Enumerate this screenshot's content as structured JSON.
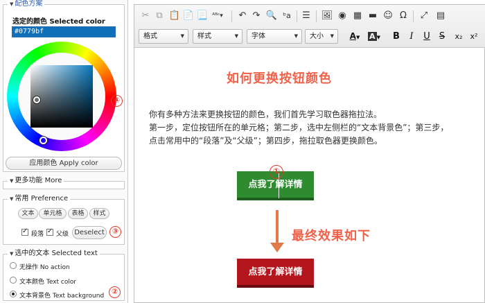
{
  "panel": {
    "color_scheme_legend": "配色方案",
    "selected_color_label": "选定的颜色 Selected color",
    "hex_value": "#0779bf",
    "apply_button": "应用颜色 Apply color",
    "more_legend": "更多功能 More",
    "preference_legend": "常用 Preference",
    "pref_buttons": [
      "文本",
      "单元格",
      "表格",
      "样式"
    ],
    "checkboxes": [
      "段落",
      "父级"
    ],
    "deselect_button": "Deselect",
    "selected_text_legend": "选中的文本 Selected text",
    "radio_options": [
      "无操作 No action",
      "文本颜色 Text color",
      "文本背景色 Text background"
    ],
    "selected_radio": 2
  },
  "badges": [
    "①",
    "②",
    "③",
    "④"
  ],
  "toolbar": {
    "format_combo": "格式",
    "style_combo": "样式",
    "font_combo": "字体",
    "size_combo": "大小",
    "bold": "B",
    "italic": "I",
    "underline": "U",
    "strike": "S",
    "subscript": "x₂",
    "superscript": "x²"
  },
  "content": {
    "title": "如何更换按钮颜色",
    "lines": [
      "你有多种方法来更换按钮的颜色，我们首先学习取色器拖拉法。",
      "第一步，定位按钮所在的单元格；第二步，选中左侧栏的“文本背景色”；第三步，",
      "点击常用中的“段落”及“父级”；第四步，拖拉取色器更换颜色。"
    ],
    "button_before": "点我了解详情",
    "button_after": "点我了解详情",
    "final_effect": "最终效果如下"
  },
  "colors": {
    "accent_text": "#f0624a",
    "button_green": "#2e8b2f",
    "button_red": "#b3161c",
    "badge": "#e23a2a",
    "selected": "#0779bf"
  },
  "icons": [
    "cut-icon",
    "copy-icon",
    "paste-icon",
    "paste-text-icon",
    "paste-word-icon",
    "spellcheck-icon",
    "undo-icon",
    "redo-icon",
    "find-icon",
    "replace-icon",
    "source-icon",
    "image-icon",
    "flash-icon",
    "table-icon",
    "horizontal-rule-icon",
    "smiley-icon",
    "special-char-icon",
    "maximize-icon",
    "show-blocks-icon",
    "text-color-icon",
    "bg-color-icon"
  ]
}
